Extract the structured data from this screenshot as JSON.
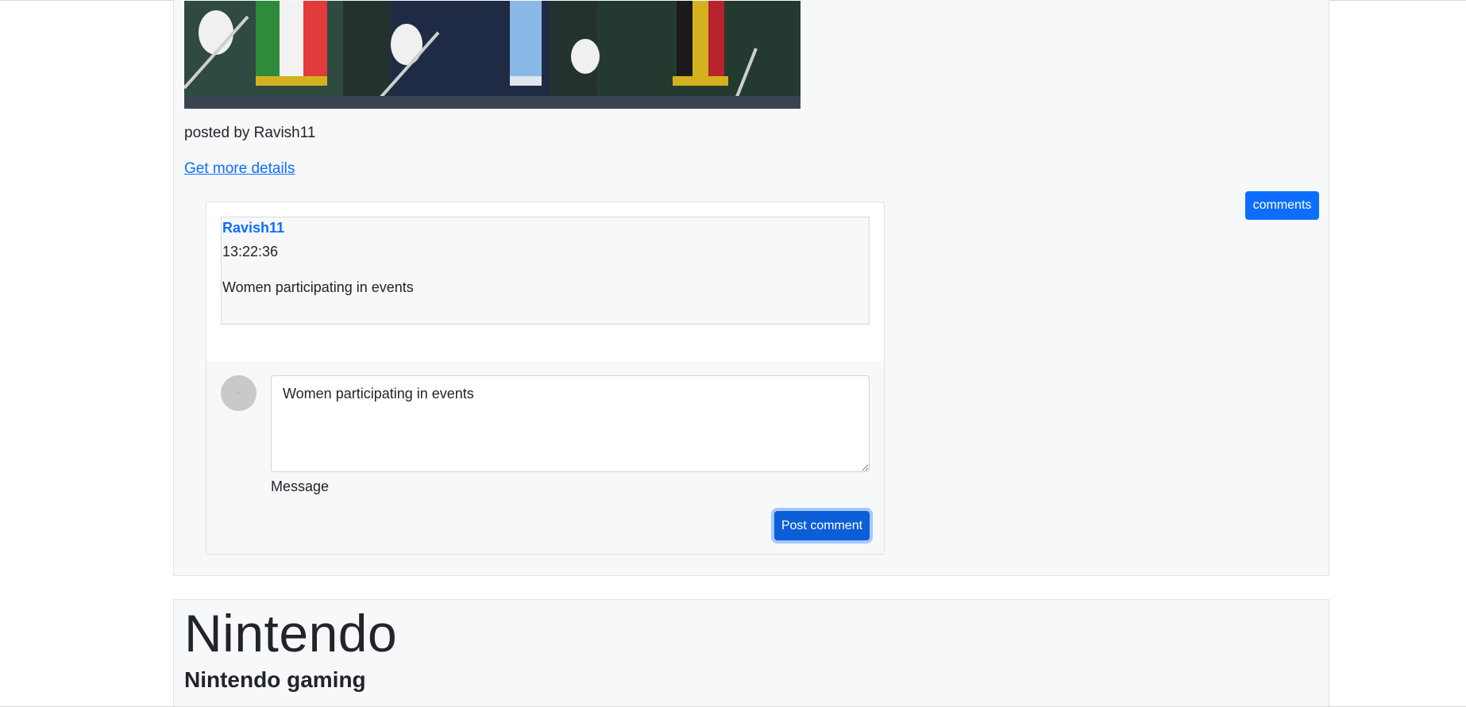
{
  "post": {
    "posted_by": "posted by Ravish11",
    "details_link": "Get more details",
    "comments_button": "comments"
  },
  "comments": {
    "items": [
      {
        "author": "Ravish11",
        "time": "13:22:36",
        "text": "Women participating in events"
      }
    ],
    "form": {
      "message_value": "Women participating in events",
      "message_label": "Message",
      "submit_label": "Post comment"
    }
  },
  "next_post": {
    "title": "Nintendo",
    "subtitle": "Nintendo gaming"
  },
  "colors": {
    "primary": "#0d6efd",
    "card_bg": "#f7f8fa",
    "border": "#dfe2e6"
  }
}
